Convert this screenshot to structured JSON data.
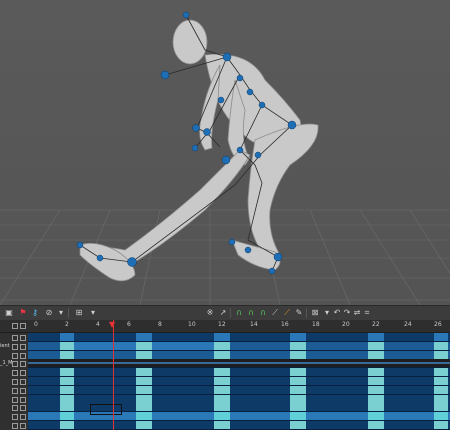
{
  "viewport": {
    "label": "3D viewport",
    "rig_colors": {
      "skin": "#c9c9c9",
      "joint": "#1e6eb5",
      "bone": "#2a2a2a",
      "grid": "#6e6e6e"
    }
  },
  "toolbar": {
    "left_tools": [
      "frame-icon",
      "flag-icon",
      "key-icon",
      "ban-icon",
      "chevron-icon",
      "zoom-icon",
      "chevron-icon"
    ],
    "center_tools": [
      "curve-icon",
      "arrow-icon",
      "ease-in-icon",
      "ease-out-icon",
      "ease-inout-icon",
      "step-icon",
      "linear-icon",
      "pencil-icon",
      "clamp-icon",
      "fit-icon",
      "undo-icon",
      "redo-icon",
      "loop-icon",
      "grid-icon"
    ]
  },
  "ruler": {
    "ticks": [
      "0",
      "2",
      "4",
      "6",
      "8",
      "10",
      "12",
      "14",
      "16",
      "18",
      "20",
      "22",
      "24",
      "26"
    ],
    "current_frame": "5"
  },
  "tracks": [
    {
      "label": "",
      "pattern": "a"
    },
    {
      "label": "ient",
      "pattern": "b"
    },
    {
      "label": "",
      "pattern": "c"
    },
    {
      "label": "_1_M",
      "pattern": "d"
    },
    {
      "label": "",
      "pattern": "e"
    },
    {
      "label": "",
      "pattern": "e"
    },
    {
      "label": "",
      "pattern": "e"
    },
    {
      "label": "",
      "pattern": "e"
    },
    {
      "label": "",
      "pattern": "f"
    },
    {
      "label": "",
      "pattern": "g"
    },
    {
      "label": "",
      "pattern": "e"
    }
  ],
  "colors": {
    "dark": "#0e3a68",
    "mid": "#1c5c94",
    "blue": "#2a78b8",
    "light": "#7ad0d0",
    "cyan": "#5fd0d8"
  }
}
